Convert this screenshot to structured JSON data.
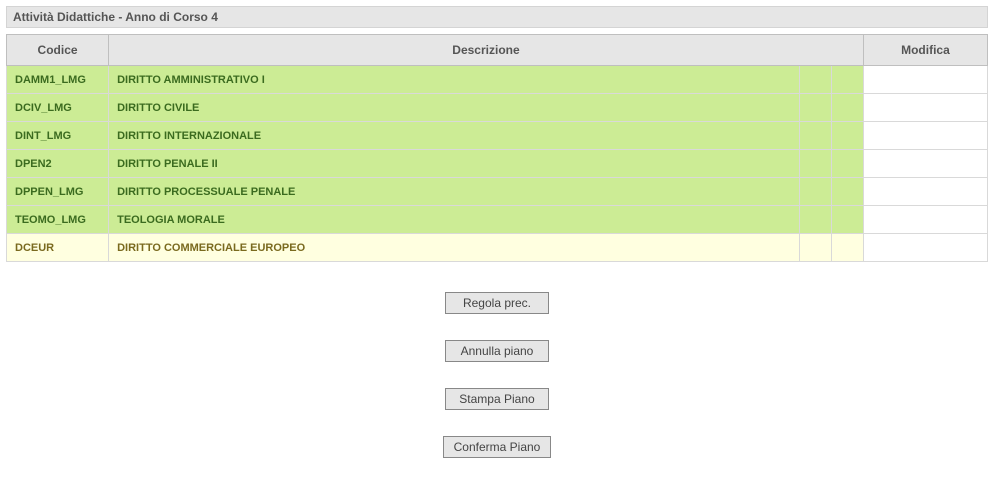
{
  "header": {
    "title": "Attività Didattiche - Anno di Corso 4"
  },
  "table": {
    "columns": {
      "code": "Codice",
      "desc": "Descrizione",
      "mod": "Modifica"
    },
    "rows": [
      {
        "code": "DAMM1_LMG",
        "desc": "DIRITTO AMMINISTRATIVO I",
        "status": "green"
      },
      {
        "code": "DCIV_LMG",
        "desc": "DIRITTO CIVILE",
        "status": "green"
      },
      {
        "code": "DINT_LMG",
        "desc": "DIRITTO INTERNAZIONALE",
        "status": "green"
      },
      {
        "code": "DPEN2",
        "desc": "DIRITTO PENALE II",
        "status": "green"
      },
      {
        "code": "DPPEN_LMG",
        "desc": "DIRITTO PROCESSUALE PENALE",
        "status": "green"
      },
      {
        "code": "TEOMO_LMG",
        "desc": "TEOLOGIA MORALE",
        "status": "green"
      },
      {
        "code": "DCEUR",
        "desc": "DIRITTO COMMERCIALE EUROPEO",
        "status": "yellow"
      }
    ]
  },
  "buttons": {
    "prev": "Regola prec.",
    "cancel": "Annulla piano",
    "print": "Stampa  Piano",
    "confirm": "Conferma Piano"
  }
}
